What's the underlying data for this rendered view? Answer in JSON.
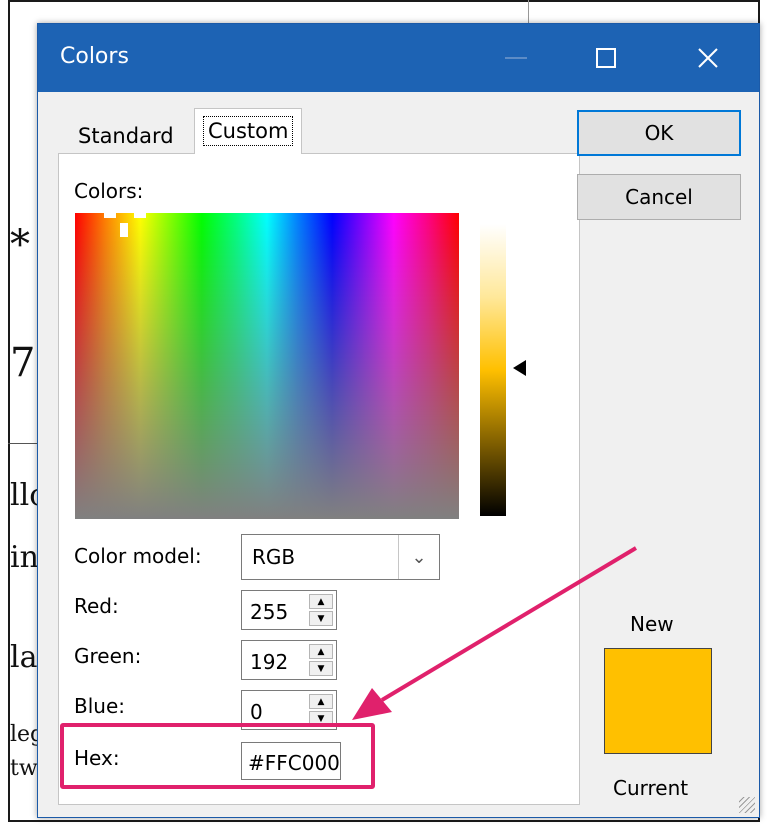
{
  "background_doc": {
    "fragments": [
      "*",
      "7",
      "llo",
      "in",
      "la",
      "leg",
      "tw"
    ]
  },
  "dialog": {
    "title": "Colors",
    "tabs": [
      {
        "label": "Standard",
        "selected": false
      },
      {
        "label": "Custom",
        "selected": true
      }
    ],
    "colors_label": "Colors:",
    "color_model": {
      "label": "Color model:",
      "value": "RGB"
    },
    "red": {
      "label": "Red:",
      "value": "255"
    },
    "green": {
      "label": "Green:",
      "value": "192"
    },
    "blue": {
      "label": "Blue:",
      "value": "0"
    },
    "hex": {
      "label": "Hex:",
      "value": "#FFC000"
    },
    "buttons": {
      "ok": "OK",
      "cancel": "Cancel"
    },
    "preview": {
      "new_label": "New",
      "current_label": "Current"
    },
    "selected_color": "#FFC000",
    "icons": {
      "minimize": "minimize-icon",
      "maximize": "maximize-icon",
      "close": "close-icon"
    }
  },
  "colors": {
    "titlebar": "#1D63B4",
    "highlight_annotation": "#E0216C",
    "swatch": "#FFC000"
  }
}
